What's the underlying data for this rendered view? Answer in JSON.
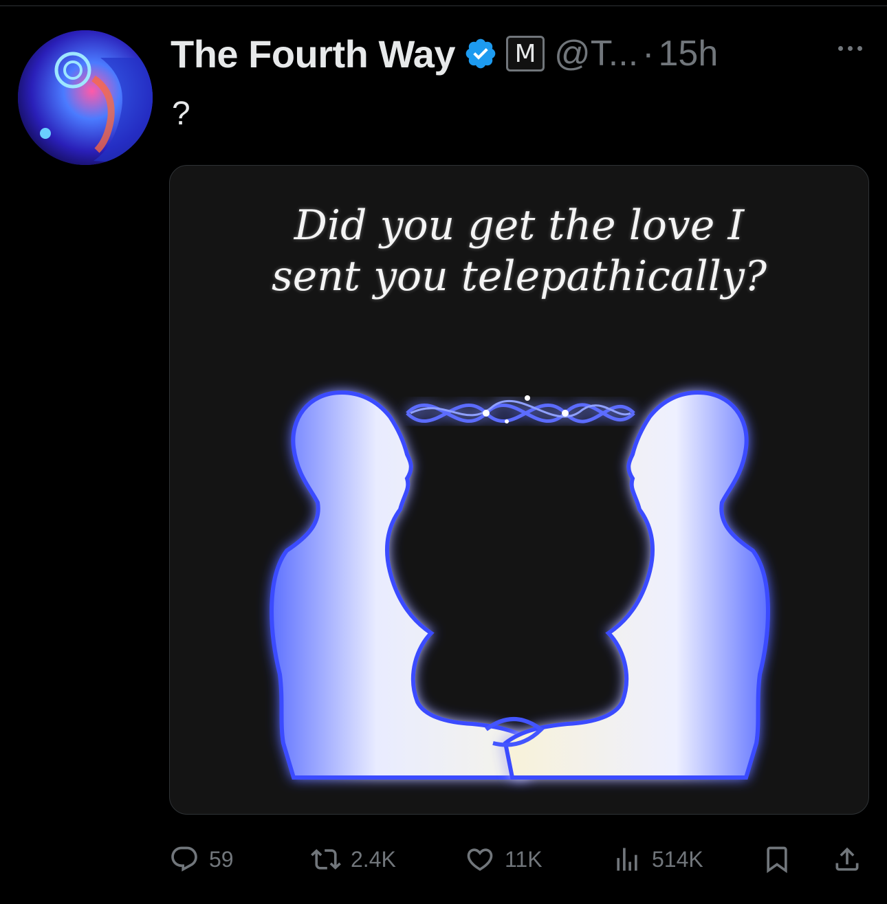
{
  "post": {
    "author_name": "The Fourth Way",
    "badge_letter": "M",
    "handle": "@T...",
    "separator": "·",
    "time": "15h",
    "text": "?"
  },
  "media": {
    "caption_line1": "Did you get the love I",
    "caption_line2": "sent you telepathically?"
  },
  "actions": {
    "replies": "59",
    "reposts": "2.4K",
    "likes": "11K",
    "views": "514K"
  },
  "colors": {
    "background": "#000000",
    "text_primary": "#e7e9ea",
    "text_secondary": "#71767b",
    "verified_blue": "#1d9bf0"
  },
  "icons": [
    "verified-badge-icon",
    "more-icon",
    "reply-icon",
    "repost-icon",
    "like-icon",
    "views-icon",
    "bookmark-icon",
    "share-icon"
  ]
}
